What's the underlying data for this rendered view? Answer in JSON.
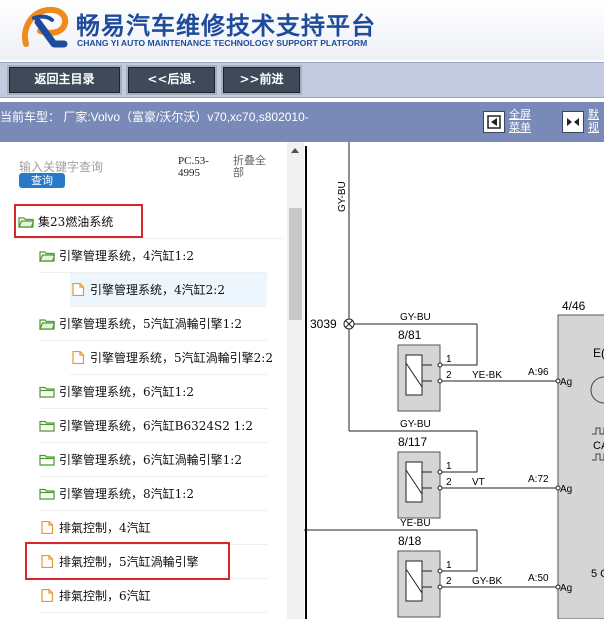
{
  "brand": {
    "title_cn": "畅易汽车维修技术支持平台",
    "title_en": "CHANG YI AUTO MAINTENANCE TECHNOLOGY SUPPORT PLATFORM",
    "colors": {
      "primary": "#1f4b9c",
      "accent_orange": "#f08a1c"
    }
  },
  "toolbar": {
    "home_label": "返回主目录",
    "back_label": "<<后退.",
    "forward_label": ">>前进"
  },
  "infobar": {
    "car_label": "当前车型：  厂家:Volvo（富豪/沃尔沃）v70,xc70,s802010-",
    "fullscreen_label_line1": "全屏",
    "fullscreen_label_line2": "菜单",
    "default_label_line1": "默",
    "default_label_line2": "视"
  },
  "sidebar": {
    "search_placeholder": "输入关键字查询",
    "search_button": "查询",
    "pc_code": "PC.53-4995",
    "collapse_all": "折叠全部",
    "items": [
      {
        "label": "集23燃油系统",
        "icon": "folder-open-icon",
        "level": 0,
        "highlighted": true
      },
      {
        "label": "引擎管理系统，4汽缸1:2",
        "icon": "folder-open-icon",
        "level": 1
      },
      {
        "label": "引擎管理系统，4汽缸2:2",
        "icon": "document-icon",
        "level": 2,
        "selected": true
      },
      {
        "label": "引擎管理系统，5汽缸渦輪引擎1:2",
        "icon": "folder-open-icon",
        "level": 1
      },
      {
        "label": "引擎管理系统，5汽缸渦輪引擎2:2",
        "icon": "document-icon",
        "level": 2
      },
      {
        "label": "引擎管理系统，6汽缸1:2",
        "icon": "folder-icon",
        "level": 1
      },
      {
        "label": "引擎管理系统，6汽缸B6324S2 1:2",
        "icon": "folder-icon",
        "level": 1
      },
      {
        "label": "引擎管理系统，6汽缸渦輪引擎1:2",
        "icon": "folder-icon",
        "level": 1
      },
      {
        "label": "引擎管理系统，8汽缸1:2",
        "icon": "folder-icon",
        "level": 1
      },
      {
        "label": "排氣控制，4汽缸",
        "icon": "document-icon",
        "level": 1
      },
      {
        "label": "排氣控制，5汽缸渦輪引擎",
        "icon": "document-icon",
        "level": 1,
        "highlighted": true
      },
      {
        "label": "排氣控制，6汽缸",
        "icon": "document-icon",
        "level": 1
      }
    ]
  },
  "diagram": {
    "wire_vertical": "GY-BU",
    "node_3039": "3039",
    "connector_446": "4/46",
    "ecu_partial": "E(",
    "can_partial": "CA",
    "five_c_partial": "5 C",
    "blocks": [
      {
        "wire_top": "GY-BU",
        "id": "8/81",
        "pin1": "1",
        "pin2": "2",
        "wire_out": "YE-BK",
        "pin_ref": "A:96",
        "ag": "Ag"
      },
      {
        "wire_top": "GY-BU",
        "id": "8/117",
        "pin1": "1",
        "pin2": "2",
        "wire_out": "VT",
        "pin_ref": "A:72",
        "ag": "Ag"
      },
      {
        "wire_top": "YE-BU",
        "id": "8/18",
        "pin1": "1",
        "pin2": "2",
        "wire_out": "GY-BK",
        "pin_ref": "A:50",
        "ag": "Ag"
      }
    ]
  }
}
